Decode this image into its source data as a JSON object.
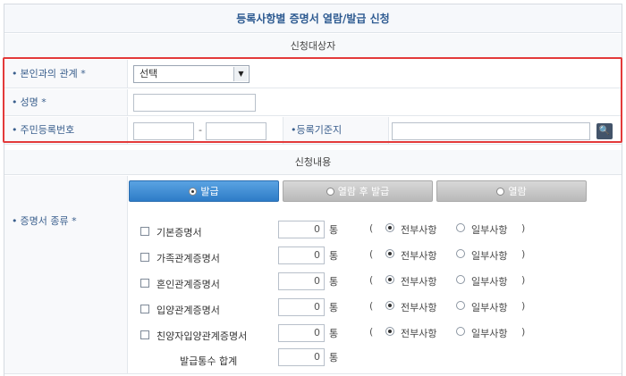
{
  "title": "등록사항별 증명서 열람/발급 신청",
  "target_section": "신청대상자",
  "content_section": "신청내용",
  "fields": {
    "relationship": {
      "label": "본인과의 관계 *",
      "value": "선택"
    },
    "name": {
      "label": "성명 *",
      "value": ""
    },
    "rrn": {
      "label": "주민등록번호",
      "front": "",
      "separator": "-",
      "back": ""
    },
    "registration_base": {
      "label": "등록기준지",
      "value": ""
    }
  },
  "tabs": [
    {
      "label": "발급",
      "active": true
    },
    {
      "label": "열람 후 발급",
      "active": false
    },
    {
      "label": "열람",
      "active": false
    }
  ],
  "cert_type_label": "증명서 종류 *",
  "cert_items": [
    {
      "label": "기본증명서",
      "count": "0"
    },
    {
      "label": "가족관계증명서",
      "count": "0"
    },
    {
      "label": "혼인관계증명서",
      "count": "0"
    },
    {
      "label": "입양관계증명서",
      "count": "0"
    },
    {
      "label": "친양자입양관계증명서",
      "count": "0"
    }
  ],
  "unit": "통",
  "paren_open": "(",
  "paren_close": ")",
  "scope_all": "전부사항",
  "scope_partial": "일부사항",
  "total": {
    "label": "발급통수 합계",
    "count": "0"
  },
  "colors": {
    "accent": "#2e7cc7",
    "highlight": "#e33a3a",
    "label_text": "#3a5f8d"
  }
}
